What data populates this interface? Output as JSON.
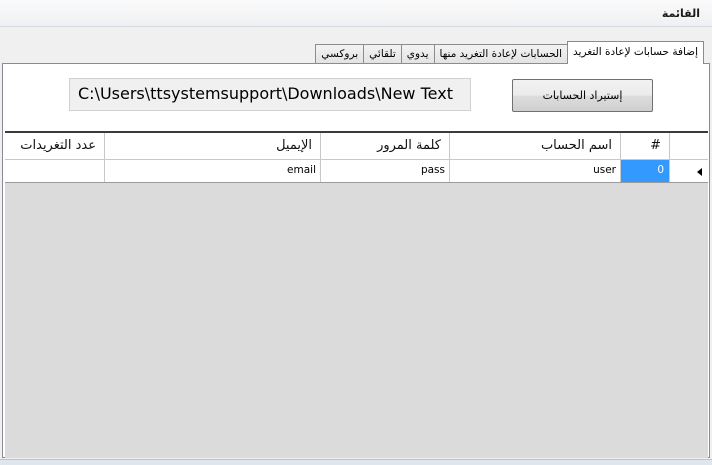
{
  "window": {
    "title": "القائمة"
  },
  "tabs": [
    {
      "label": "إضافة حسابات لإعادة التغريد",
      "active": true
    },
    {
      "label": "الحسابات لإعادة التغريد منها",
      "active": false
    },
    {
      "label": "يدوي",
      "active": false
    },
    {
      "label": "تلقائي",
      "active": false
    },
    {
      "label": "بروكسي",
      "active": false
    }
  ],
  "import_panel": {
    "path_value": "C:\\Users\\ttsystemsupport\\Downloads\\New Text",
    "import_button_label": "إستيراد الحسابات"
  },
  "grid": {
    "columns": {
      "num": "#",
      "account_name": "اسم الحساب",
      "password": "كلمة المرور",
      "email": "الإيميل",
      "retweet_count": "عدد التغريدات"
    },
    "rows": [
      {
        "num": "0",
        "account_name": "user",
        "password": "pass",
        "email": "email",
        "retweet_count": ""
      }
    ]
  },
  "colors": {
    "selected_cell": "#3399ff",
    "grid_background": "#dbdbdb"
  }
}
